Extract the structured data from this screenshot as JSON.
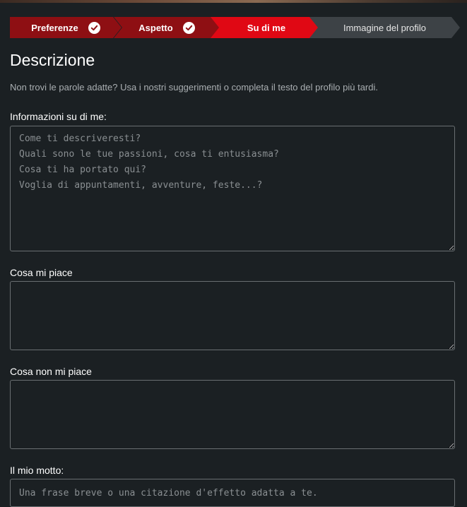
{
  "stepper": {
    "steps": [
      {
        "label": "Preferenze",
        "state": "done"
      },
      {
        "label": "Aspetto",
        "state": "done"
      },
      {
        "label": "Su di me",
        "state": "active"
      },
      {
        "label": "Immagine del profilo",
        "state": "todo"
      }
    ]
  },
  "page": {
    "title": "Descrizione",
    "subtitle": "Non trovi le parole adatte? Usa i nostri suggerimenti o completa il testo del profilo più tardi."
  },
  "fields": {
    "about": {
      "label": "Informazioni su di me:",
      "value": "",
      "placeholder": "Come ti descriveresti?\nQuali sono le tue passioni, cosa ti entusiasma?\nCosa ti ha portato qui?\nVoglia di appuntamenti, avventure, feste...?"
    },
    "likes": {
      "label": "Cosa mi piace",
      "value": "",
      "placeholder": ""
    },
    "dislikes": {
      "label": "Cosa non mi piace",
      "value": "",
      "placeholder": ""
    },
    "motto": {
      "label": "Il mio motto:",
      "value": "",
      "placeholder": "Una frase breve o una citazione d'effetto adatta a te."
    }
  },
  "colors": {
    "background": "#1b2023",
    "step_done": "#8e0f13",
    "step_active": "#e00814",
    "step_todo": "#3d4246",
    "field_border": "#6a6f72"
  }
}
